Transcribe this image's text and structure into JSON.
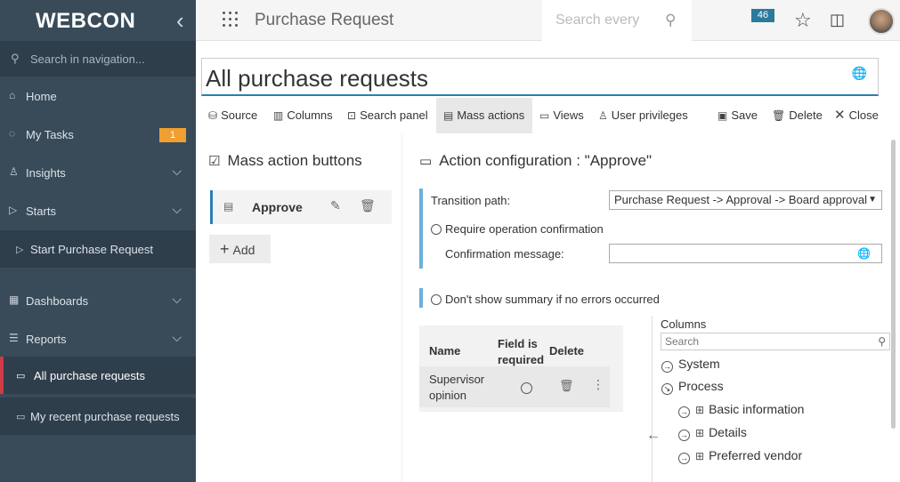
{
  "sidebar": {
    "logo": "WEBCON",
    "search_placeholder": "Search in navigation...",
    "items": [
      {
        "label": "Home"
      },
      {
        "label": "My Tasks",
        "badge": "1"
      },
      {
        "label": "Insights"
      },
      {
        "label": "Starts"
      },
      {
        "label": "Start Purchase Request"
      },
      {
        "label": "Dashboards"
      },
      {
        "label": "Reports"
      },
      {
        "label": "All purchase requests"
      },
      {
        "label": "My recent purchase requests"
      }
    ]
  },
  "topbar": {
    "app_title": "Purchase Request",
    "search_placeholder": "Search every",
    "notifications": "46"
  },
  "report_title": "All purchase requests",
  "toolbar": {
    "source": "Source",
    "columns": "Columns",
    "search_panel": "Search panel",
    "mass_actions": "Mass actions",
    "views": "Views",
    "user_privileges": "User privileges",
    "save": "Save",
    "delete": "Delete",
    "close": "Close"
  },
  "mass_actions": {
    "header": "Mass action buttons",
    "buttons": [
      {
        "label": "Approve"
      }
    ],
    "add_label": "Add"
  },
  "config": {
    "header": "Action configuration : \"Approve\"",
    "transition_label": "Transition path:",
    "transition_value": "Purchase Request -> Approval -> Board approval",
    "require_confirmation": "Require operation confirmation",
    "confirmation_label": "Confirmation message:",
    "no_summary": "Don't show summary if no errors occurred",
    "table": {
      "headers": [
        "Name",
        "Field is required",
        "Delete"
      ],
      "rows": [
        {
          "name": "Supervisor opinion"
        }
      ]
    }
  },
  "columns_panel": {
    "title": "Columns",
    "search_placeholder": "Search",
    "tree": [
      "System",
      "Process",
      "Basic information",
      "Details",
      "Preferred vendor"
    ]
  },
  "colors": {
    "sidebar": "#394b59",
    "accent": "#2a7fb0",
    "badge": "#f0a030",
    "active": "#d03a46"
  }
}
